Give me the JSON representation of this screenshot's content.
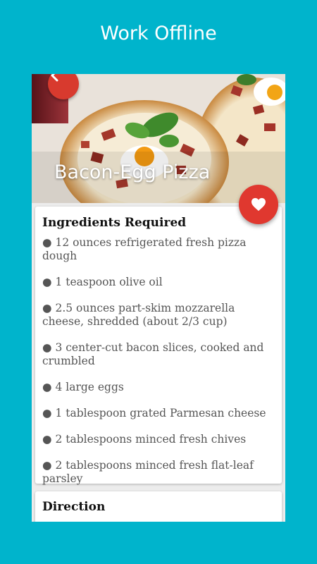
{
  "header": {
    "title": "Work Offline"
  },
  "recipe": {
    "title": "Bacon-Egg Pizza",
    "ingredients_heading": "Ingredients Required",
    "ingredients": [
      "● 12 ounces refrigerated fresh pizza dough",
      " ●  1 teaspoon olive oil",
      " ● 2.5 ounces part-skim mozzarella cheese, shredded (about 2/3 cup)",
      " ● 3 center-cut bacon slices, cooked and crumbled",
      " ● 4 large eggs",
      " ● 1 tablespoon grated Parmesan cheese",
      "  ● 2 tablespoons minced fresh chives",
      " ● 2 tablespoons minced fresh flat-leaf parsley"
    ],
    "direction_heading": "Direction"
  },
  "icons": {
    "back": "chevron-left-icon",
    "favorite": "heart-icon"
  },
  "colors": {
    "background": "#00b4cc",
    "accent": "#e0382f",
    "text": "#555555"
  }
}
